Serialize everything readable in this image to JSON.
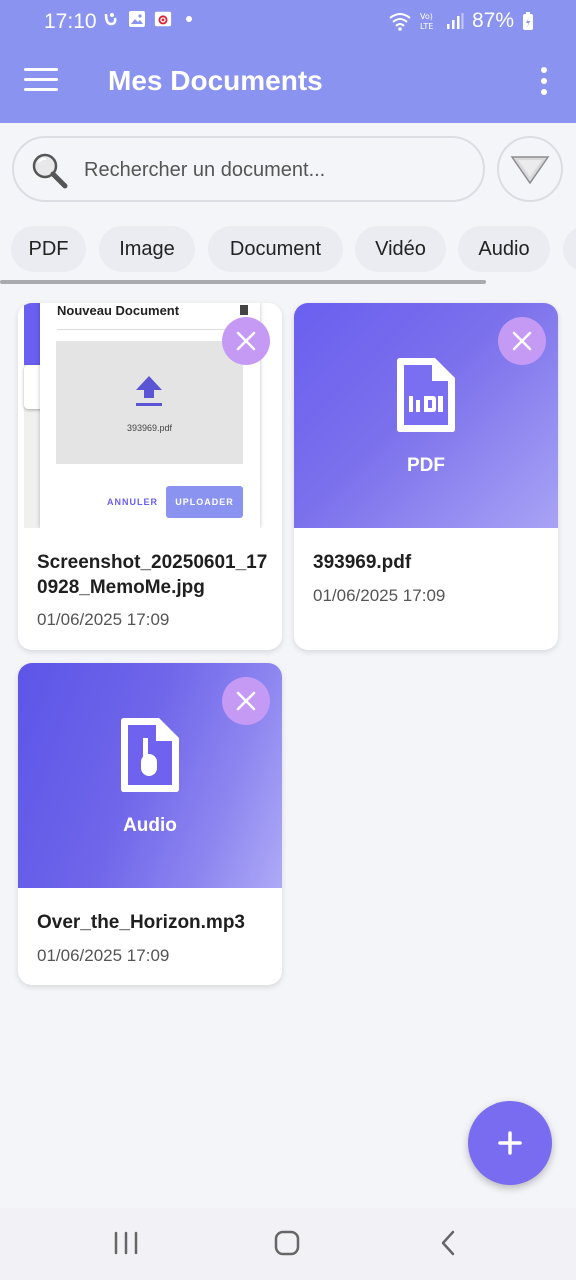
{
  "status_bar": {
    "time": "17:10",
    "battery_percent": "87%"
  },
  "app_bar": {
    "title": "Mes Documents",
    "menu_icon": "hamburger-menu-icon",
    "more_icon": "more-vert-icon",
    "background_color": "#8a93f0"
  },
  "search": {
    "placeholder": "Rechercher un document...",
    "value": "",
    "icon": "search-icon",
    "filter_icon": "triangle-down-icon"
  },
  "filters": {
    "chips": [
      {
        "label": "PDF"
      },
      {
        "label": "Image"
      },
      {
        "label": "Document"
      },
      {
        "label": "Vidéo"
      },
      {
        "label": "Audio"
      }
    ]
  },
  "documents": [
    {
      "name": "Screenshot_20250601_170928_MemoMe.jpg",
      "date": "01/06/2025 17:09",
      "type": "image",
      "preview": {
        "dialog_title": "Nouveau Document",
        "file_name": "393969.pdf",
        "cancel_label": "ANNULER",
        "upload_label": "UPLOADER"
      }
    },
    {
      "name": "393969.pdf",
      "date": "01/06/2025 17:09",
      "type_label": "PDF",
      "icon": "pdf-file-icon"
    },
    {
      "name": "Over_the_Horizon.mp3",
      "date": "01/06/2025 17:09",
      "type_label": "Audio",
      "icon": "audio-file-icon"
    }
  ],
  "fab": {
    "icon": "plus-icon",
    "color": "#7a6cf0"
  },
  "nav_bar": {
    "recents_icon": "recents-icon",
    "home_icon": "home-icon",
    "back_icon": "back-icon"
  }
}
